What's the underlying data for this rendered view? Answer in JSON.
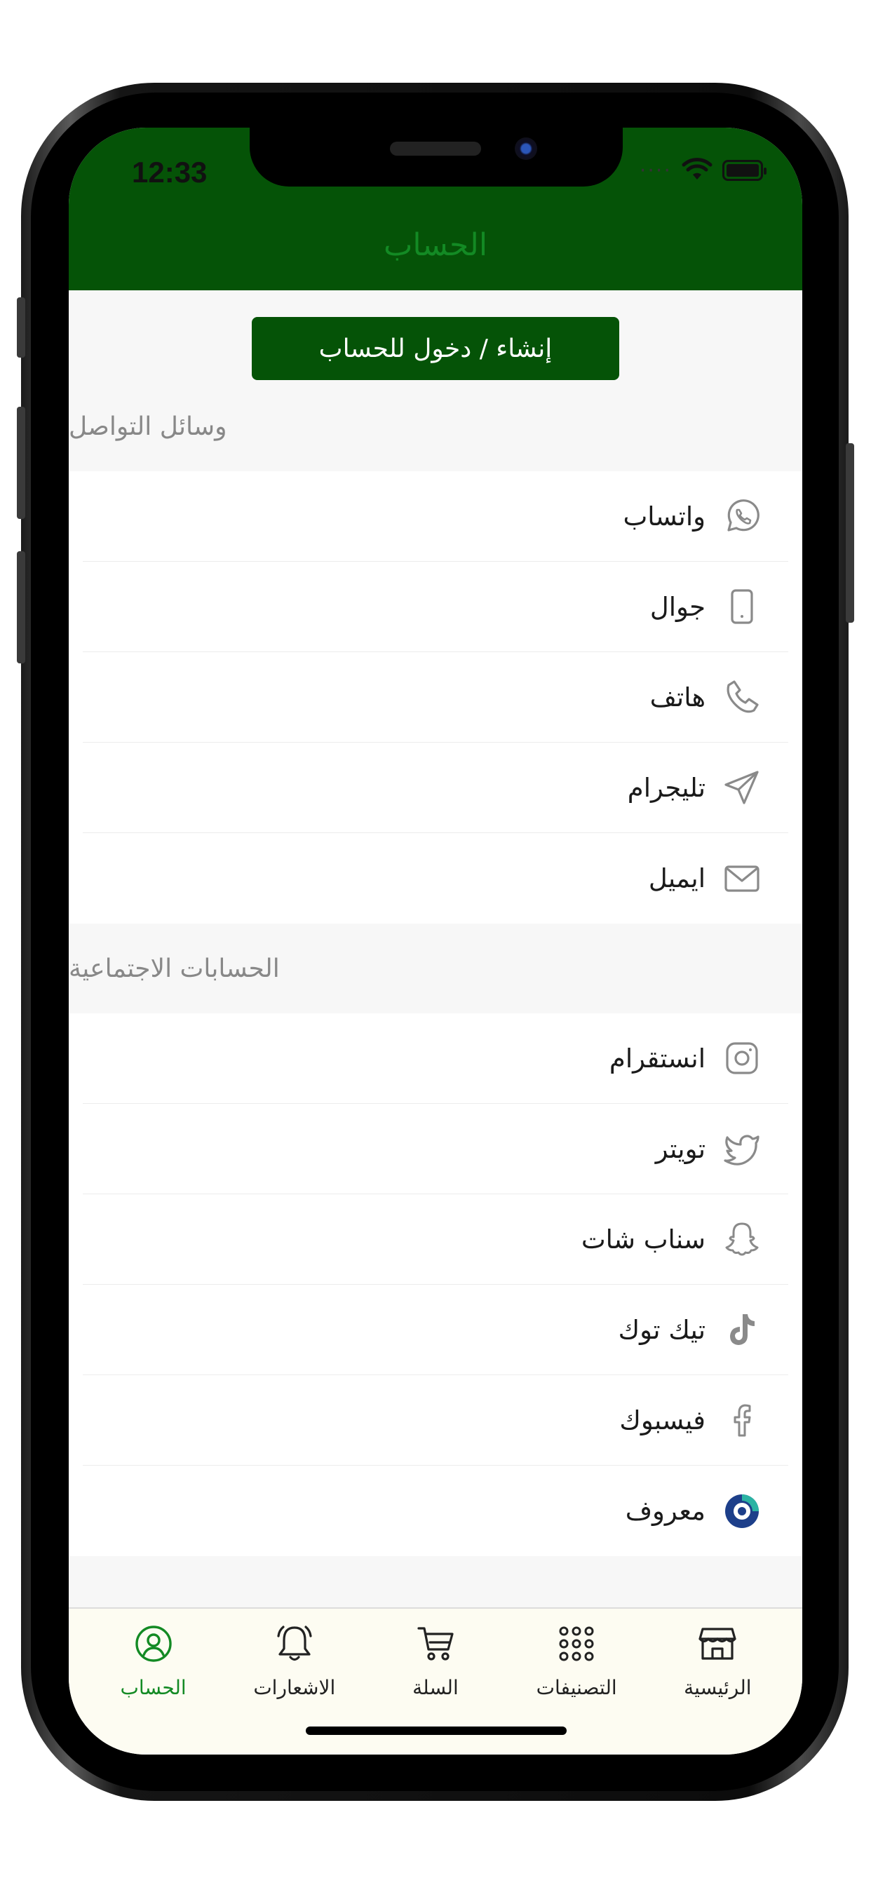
{
  "status_bar": {
    "time": "12:33",
    "signal": "····"
  },
  "header": {
    "title": "الحساب"
  },
  "login_button": {
    "label": "إنشاء / دخول للحساب"
  },
  "sections": {
    "contact": {
      "title": "وسائل التواصل",
      "items": [
        {
          "label": "واتساب",
          "icon": "whatsapp-icon"
        },
        {
          "label": "جوال",
          "icon": "mobile-icon"
        },
        {
          "label": "هاتف",
          "icon": "phone-icon"
        },
        {
          "label": "تليجرام",
          "icon": "telegram-icon"
        },
        {
          "label": "ايميل",
          "icon": "email-icon"
        }
      ]
    },
    "social": {
      "title": "الحسابات الاجتماعية",
      "items": [
        {
          "label": "انستقرام",
          "icon": "instagram-icon"
        },
        {
          "label": "تويتر",
          "icon": "twitter-icon"
        },
        {
          "label": "سناب شات",
          "icon": "snapchat-icon"
        },
        {
          "label": "تيك توك",
          "icon": "tiktok-icon"
        },
        {
          "label": "فيسبوك",
          "icon": "facebook-icon"
        },
        {
          "label": "معروف",
          "icon": "maroof-icon"
        }
      ]
    }
  },
  "tabbar": {
    "items": [
      {
        "label": "الرئيسية",
        "icon": "store-icon"
      },
      {
        "label": "التصنيفات",
        "icon": "grid-icon"
      },
      {
        "label": "السلة",
        "icon": "cart-icon"
      },
      {
        "label": "الاشعارات",
        "icon": "bell-icon"
      },
      {
        "label": "الحساب",
        "icon": "account-icon",
        "active": true
      }
    ]
  },
  "colors": {
    "primary": "#055307",
    "active_tab": "#138a24",
    "icon_gray": "#8a8a8a"
  }
}
